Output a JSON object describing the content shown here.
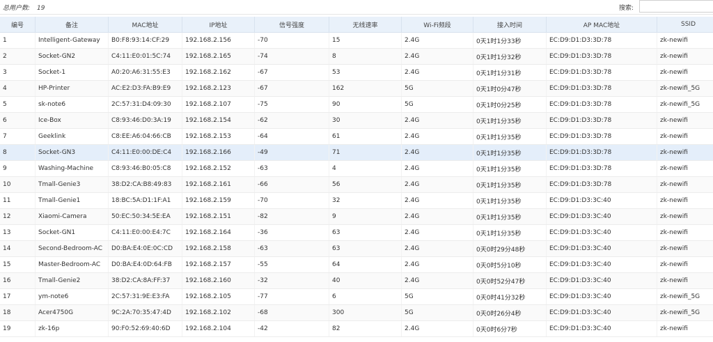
{
  "header": {
    "total_label": "总用户数:",
    "total_count": "19",
    "search_label": "搜索:",
    "search_value": ""
  },
  "table": {
    "columns": [
      "编号",
      "备注",
      "MAC地址",
      "IP地址",
      "信号强度",
      "无线速率",
      "Wi-Fi频段",
      "接入时间",
      "AP MAC地址",
      "SSID"
    ],
    "selected_row": 7,
    "rows": [
      [
        "1",
        "Intelligent-Gateway",
        "B0:F8:93:14:CF:29",
        "192.168.2.156",
        "-70",
        "15",
        "2.4G",
        "0天1时1分33秒",
        "EC:D9:D1:D3:3D:78",
        "zk-newifi"
      ],
      [
        "2",
        "Socket-GN2",
        "C4:11:E0:01:5C:74",
        "192.168.2.165",
        "-74",
        "8",
        "2.4G",
        "0天1时1分32秒",
        "EC:D9:D1:D3:3D:78",
        "zk-newifi"
      ],
      [
        "3",
        "Socket-1",
        "A0:20:A6:31:55:E3",
        "192.168.2.162",
        "-67",
        "53",
        "2.4G",
        "0天1时1分31秒",
        "EC:D9:D1:D3:3D:78",
        "zk-newifi"
      ],
      [
        "4",
        "HP-Printer",
        "AC:E2:D3:FA:B9:E9",
        "192.168.2.123",
        "-67",
        "162",
        "5G",
        "0天1时0分47秒",
        "EC:D9:D1:D3:3D:78",
        "zk-newifi_5G"
      ],
      [
        "5",
        "sk-note6",
        "2C:57:31:D4:09:30",
        "192.168.2.107",
        "-75",
        "90",
        "5G",
        "0天1时0分25秒",
        "EC:D9:D1:D3:3D:78",
        "zk-newifi_5G"
      ],
      [
        "6",
        "Ice-Box",
        "C8:93:46:D0:3A:19",
        "192.168.2.154",
        "-62",
        "30",
        "2.4G",
        "0天1时1分35秒",
        "EC:D9:D1:D3:3D:78",
        "zk-newifi"
      ],
      [
        "7",
        "Geeklink",
        "C8:EE:A6:04:66:CB",
        "192.168.2.153",
        "-64",
        "61",
        "2.4G",
        "0天1时1分35秒",
        "EC:D9:D1:D3:3D:78",
        "zk-newifi"
      ],
      [
        "8",
        "Socket-GN3",
        "C4:11:E0:00:DE:C4",
        "192.168.2.166",
        "-49",
        "71",
        "2.4G",
        "0天1时1分35秒",
        "EC:D9:D1:D3:3D:78",
        "zk-newifi"
      ],
      [
        "9",
        "Washing-Machine",
        "C8:93:46:B0:05:C8",
        "192.168.2.152",
        "-63",
        "4",
        "2.4G",
        "0天1时1分35秒",
        "EC:D9:D1:D3:3D:78",
        "zk-newifi"
      ],
      [
        "10",
        "Tmall-Genie3",
        "38:D2:CA:B8:49:83",
        "192.168.2.161",
        "-66",
        "56",
        "2.4G",
        "0天1时1分35秒",
        "EC:D9:D1:D3:3D:78",
        "zk-newifi"
      ],
      [
        "11",
        "Tmall-Genie1",
        "18:BC:5A:D1:1F:A1",
        "192.168.2.159",
        "-70",
        "32",
        "2.4G",
        "0天1时1分35秒",
        "EC:D9:D1:D3:3C:40",
        "zk-newifi"
      ],
      [
        "12",
        "Xiaomi-Camera",
        "50:EC:50:34:5E:EA",
        "192.168.2.151",
        "-82",
        "9",
        "2.4G",
        "0天1时1分35秒",
        "EC:D9:D1:D3:3C:40",
        "zk-newifi"
      ],
      [
        "13",
        "Socket-GN1",
        "C4:11:E0:00:E4:7C",
        "192.168.2.164",
        "-36",
        "63",
        "2.4G",
        "0天1时1分35秒",
        "EC:D9:D1:D3:3C:40",
        "zk-newifi"
      ],
      [
        "14",
        "Second-Bedroom-AC",
        "D0:BA:E4:0E:0C:CD",
        "192.168.2.158",
        "-63",
        "63",
        "2.4G",
        "0天0时29分48秒",
        "EC:D9:D1:D3:3C:40",
        "zk-newifi"
      ],
      [
        "15",
        "Master-Bedroom-AC",
        "D0:BA:E4:0D:64:FB",
        "192.168.2.157",
        "-55",
        "64",
        "2.4G",
        "0天0时5分10秒",
        "EC:D9:D1:D3:3C:40",
        "zk-newifi"
      ],
      [
        "16",
        "Tmall-Genie2",
        "38:D2:CA:8A:FF:37",
        "192.168.2.160",
        "-32",
        "40",
        "2.4G",
        "0天0时52分47秒",
        "EC:D9:D1:D3:3C:40",
        "zk-newifi"
      ],
      [
        "17",
        "ym-note6",
        "2C:57:31:9E:E3:FA",
        "192.168.2.105",
        "-77",
        "6",
        "5G",
        "0天0时41分32秒",
        "EC:D9:D1:D3:3C:40",
        "zk-newifi_5G"
      ],
      [
        "18",
        "Acer4750G",
        "9C:2A:70:35:47:4D",
        "192.168.2.102",
        "-68",
        "300",
        "5G",
        "0天0时26分4秒",
        "EC:D9:D1:D3:3C:40",
        "zk-newifi_5G"
      ],
      [
        "19",
        "zk-16p",
        "90:F0:52:69:40:6D",
        "192.168.2.104",
        "-42",
        "82",
        "2.4G",
        "0天0时6分7秒",
        "EC:D9:D1:D3:3C:40",
        "zk-newifi"
      ]
    ]
  }
}
